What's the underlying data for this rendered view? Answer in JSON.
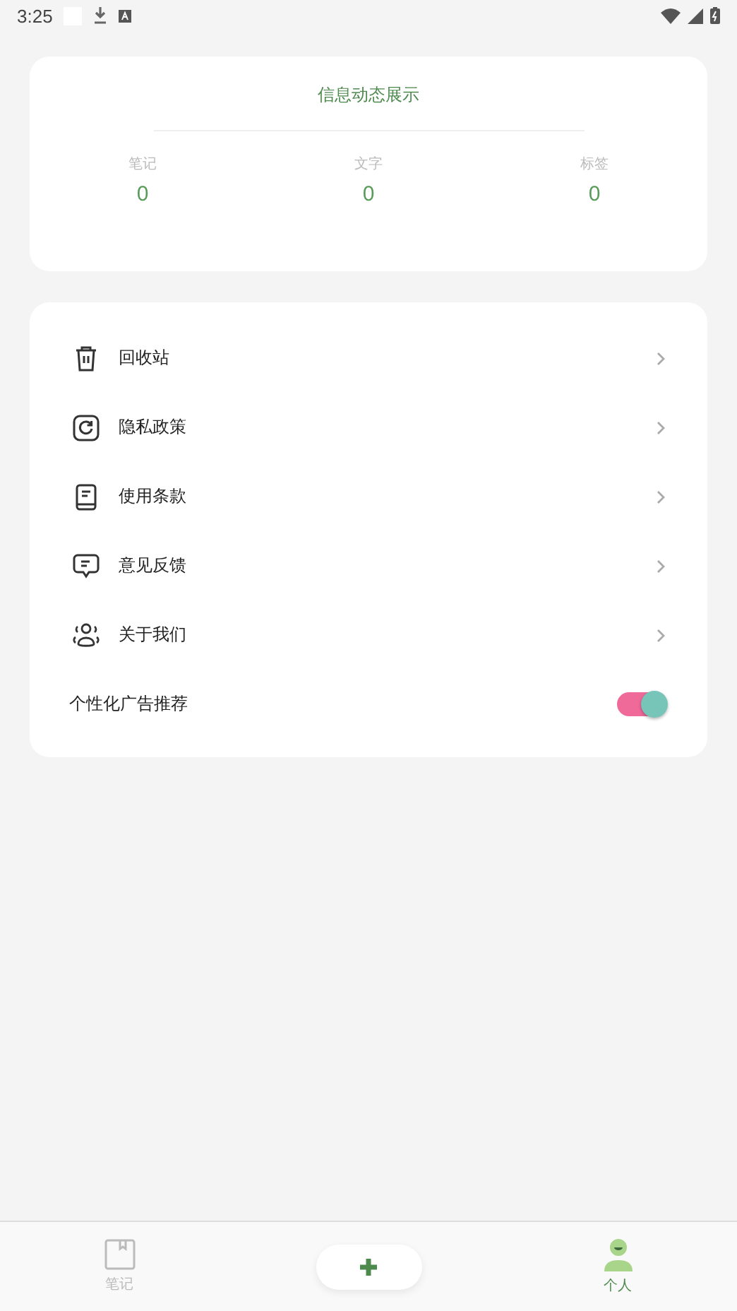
{
  "status_bar": {
    "time": "3:25"
  },
  "stats_card": {
    "title": "信息动态展示",
    "stats": [
      {
        "label": "笔记",
        "value": "0"
      },
      {
        "label": "文字",
        "value": "0"
      },
      {
        "label": "标签",
        "value": "0"
      }
    ]
  },
  "menu": [
    {
      "kind": "link",
      "label": "回收站"
    },
    {
      "kind": "link",
      "label": "隐私政策"
    },
    {
      "kind": "link",
      "label": "使用条款"
    },
    {
      "kind": "link",
      "label": "意见反馈"
    },
    {
      "kind": "link",
      "label": "关于我们"
    },
    {
      "kind": "toggle",
      "label": "个性化广告推荐",
      "on": true
    }
  ],
  "bottom_nav": [
    {
      "label": "笔记",
      "selected": false
    },
    {
      "label": "个人",
      "selected": true
    }
  ]
}
